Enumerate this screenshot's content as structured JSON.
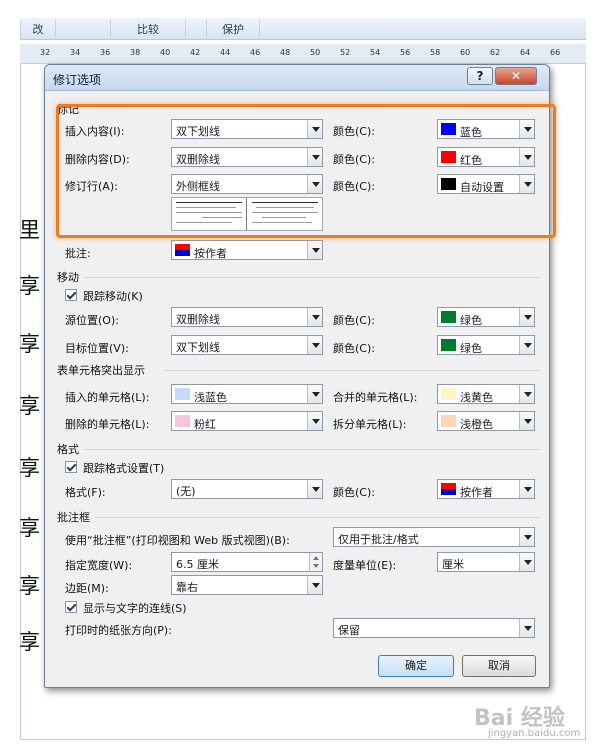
{
  "ribbon": {
    "tabs": [
      "改",
      "比较",
      "保护"
    ]
  },
  "ruler": {
    "ticks": [
      "32",
      "34",
      "36",
      "38",
      "40",
      "42",
      "44",
      "46",
      "48",
      "50",
      "52",
      "54",
      "56",
      "58",
      "60",
      "62",
      "64",
      "66"
    ]
  },
  "document": {
    "glyphs": [
      "里",
      "享",
      "享",
      "享",
      "享",
      "享",
      "享",
      "享"
    ]
  },
  "watermark": {
    "text": "Bai  经验",
    "sub": "jingyan.baidu.com"
  },
  "dialog": {
    "title": "修订选项",
    "help_label": "?",
    "close_label": "✕",
    "markup": {
      "section": "标记",
      "insert": {
        "label": "插入内容(I):",
        "value": "双下划线",
        "color_label": "颜色(C):",
        "color": "蓝色",
        "swatch": "#0000ff"
      },
      "delete": {
        "label": "删除内容(D):",
        "value": "双删除线",
        "color_label": "颜色(C):",
        "color": "红色",
        "swatch": "#ff0000"
      },
      "changed_line": {
        "label": "修订行(A):",
        "value": "外侧框线",
        "color_label": "颜色(C):",
        "color": "自动设置",
        "swatch": "#000000"
      },
      "comment": {
        "label": "批注:",
        "value": "按作者"
      }
    },
    "move": {
      "section": "移动",
      "track_label": "跟踪移动(K)",
      "from": {
        "label": "源位置(O):",
        "value": "双删除线",
        "color_label": "颜色(C):",
        "color": "绿色",
        "swatch": "#007a2e"
      },
      "to": {
        "label": "目标位置(V):",
        "value": "双下划线",
        "color_label": "颜色(C):",
        "color": "绿色",
        "swatch": "#007a2e"
      }
    },
    "table": {
      "section": "表单元格突出显示",
      "inserted": {
        "label": "插入的单元格(L):",
        "value": "浅蓝色",
        "swatch": "#c5dcf2"
      },
      "merged": {
        "label": "合并的单元格(L):",
        "value": "浅黄色",
        "swatch": "#fff7c3"
      },
      "deleted": {
        "label": "删除的单元格(L):",
        "value": "粉红",
        "swatch": "#f7c6d8"
      },
      "split": {
        "label": "拆分单元格(L):",
        "value": "浅橙色",
        "swatch": "#fbd7ba"
      }
    },
    "format": {
      "section": "格式",
      "track_label": "跟踪格式设置(T)",
      "format_label": "格式(F):",
      "format_value": "(无)",
      "color_label": "颜色(C):",
      "color": "按作者"
    },
    "balloons": {
      "section": "批注框",
      "use_label": "使用“批注框”(打印视图和 Web 版式视图)(B):",
      "use_value": "仅用于批注/格式",
      "width_label": "指定宽度(W):",
      "width_value": "6.5 厘米",
      "unit_label": "度量单位(E):",
      "unit_value": "厘米",
      "margin_label": "边距(M):",
      "margin_value": "靠右",
      "lines_label": "显示与文字的连线(S)",
      "orientation_label": "打印时的纸张方向(P):",
      "orientation_value": "保留"
    },
    "ok_label": "确定",
    "cancel_label": "取消"
  },
  "colors": {
    "highlight": "#f07b1e",
    "author_top": "#ff0000",
    "author_bottom": "#0000cc"
  }
}
